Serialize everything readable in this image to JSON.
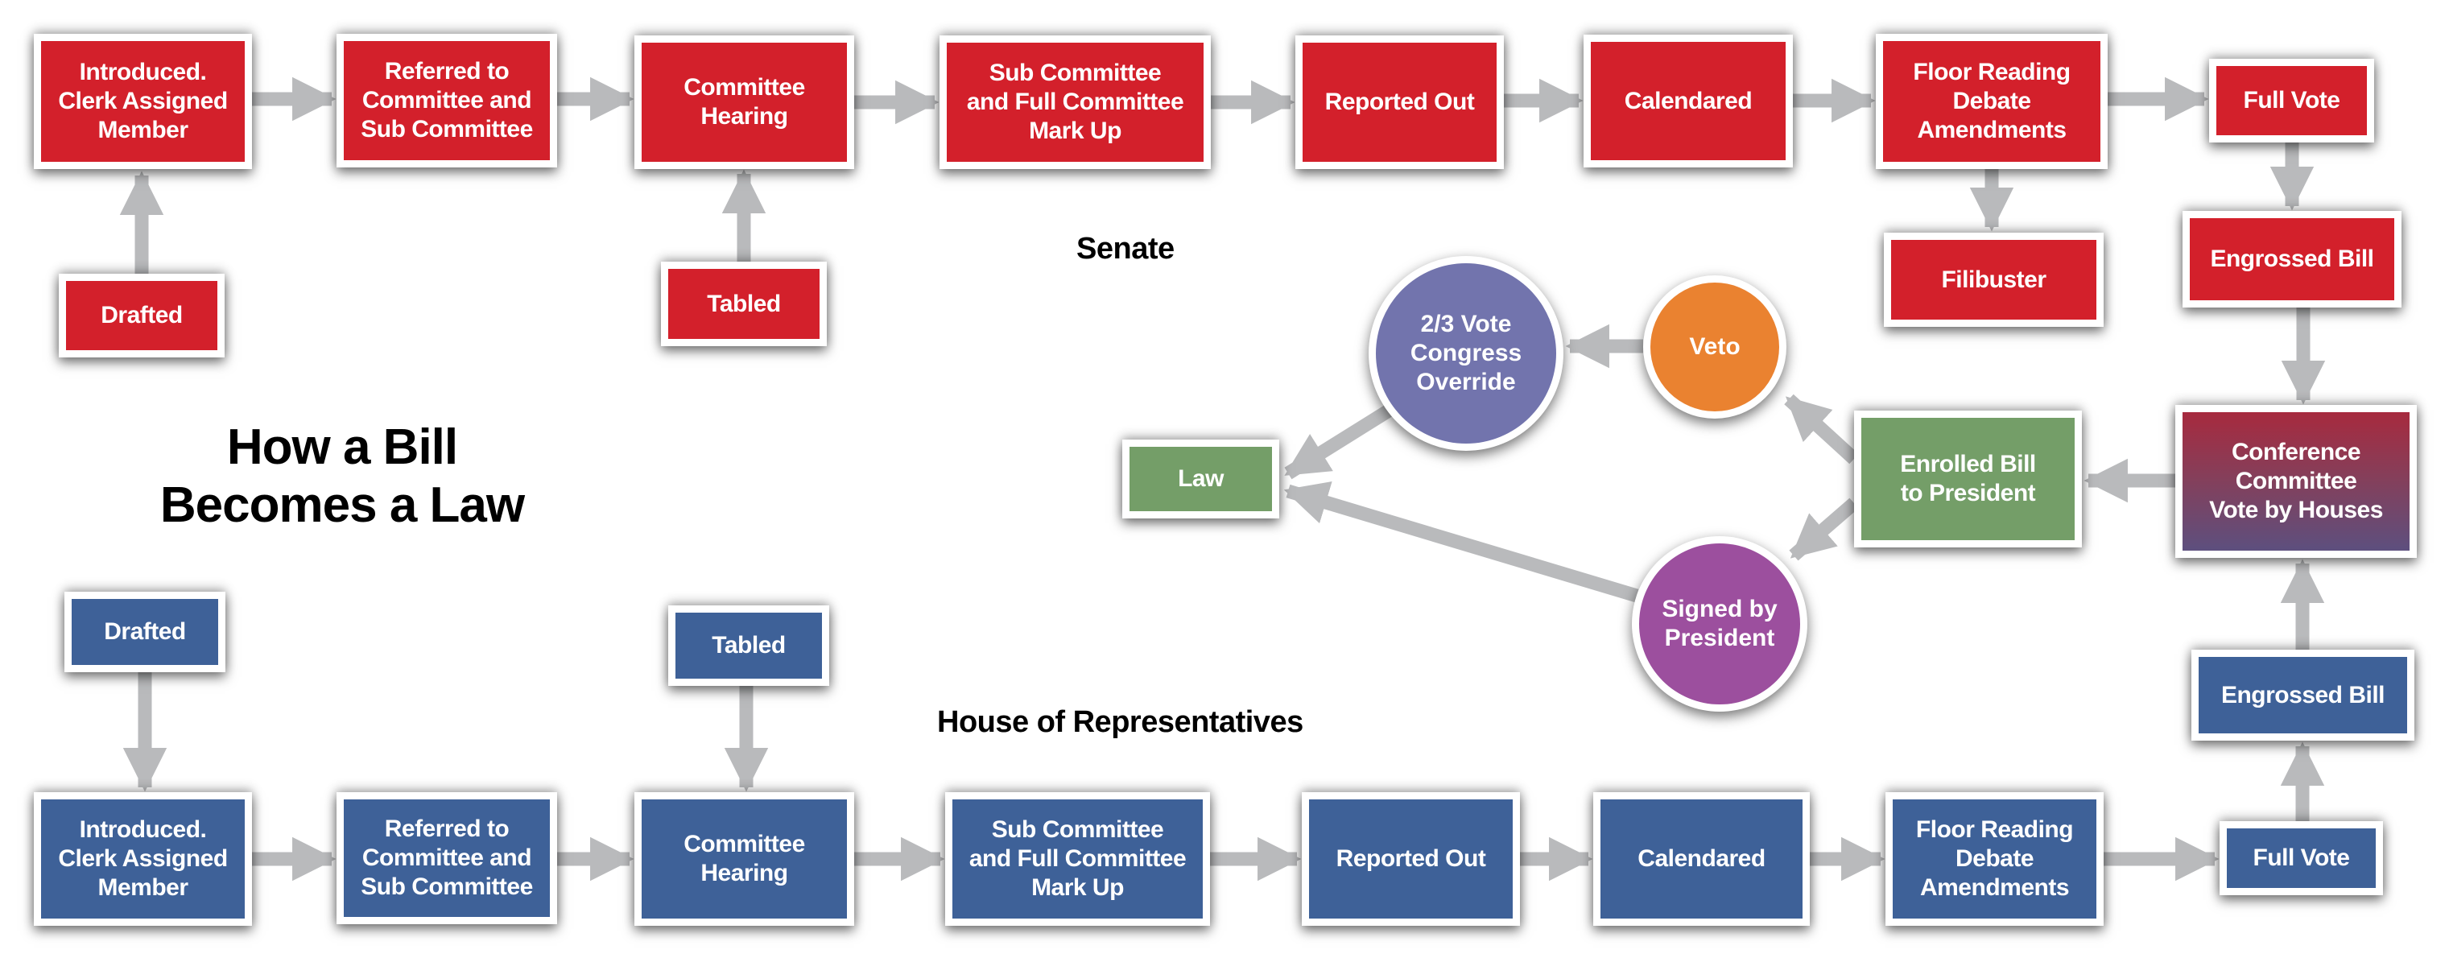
{
  "title": {
    "line1": "How a Bill",
    "line2": "Becomes a Law"
  },
  "labels": {
    "senate": "Senate",
    "house": "House of Representatives"
  },
  "colors": {
    "senate": "#d3202b",
    "house": "#3e6198",
    "law_green": "#749e68",
    "override_purple": "#7274ad",
    "veto_orange": "#ea8230",
    "signed_purple": "#9c4f9e",
    "arrow_gray": "#b9babc"
  },
  "senate": {
    "drafted": "Drafted",
    "introduced": "Introduced.\nClerk Assigned\nMember",
    "referred": "Referred to\nCommittee and\nSub Committee",
    "hearing": "Committee\nHearing",
    "tabled": "Tabled",
    "markup": "Sub Committee\nand Full Committee\nMark Up",
    "reported": "Reported Out",
    "calendared": "Calendared",
    "floor": "Floor Reading\nDebate\nAmendments",
    "filibuster": "Filibuster",
    "full_vote": "Full Vote",
    "engrossed": "Engrossed Bill"
  },
  "house": {
    "drafted": "Drafted",
    "introduced": "Introduced.\nClerk Assigned\nMember",
    "referred": "Referred to\nCommittee and\nSub Committee",
    "hearing": "Committee\nHearing",
    "tabled": "Tabled",
    "markup": "Sub Committee\nand Full Committee\nMark Up",
    "reported": "Reported Out",
    "calendared": "Calendared",
    "floor": "Floor Reading\nDebate\nAmendments",
    "full_vote": "Full Vote",
    "engrossed": "Engrossed Bill"
  },
  "final": {
    "conference": "Conference\nCommittee\nVote by Houses",
    "enrolled": "Enrolled Bill\nto President",
    "veto": "Veto",
    "override": "2/3 Vote\nCongress\nOverride",
    "signed": "Signed by\nPresident",
    "law": "Law"
  },
  "edges": [
    [
      "senate-drafted",
      "senate-introduced"
    ],
    [
      "senate-introduced",
      "senate-referred"
    ],
    [
      "senate-referred",
      "senate-hearing"
    ],
    [
      "senate-tabled",
      "senate-hearing"
    ],
    [
      "senate-hearing",
      "senate-markup"
    ],
    [
      "senate-markup",
      "senate-reported"
    ],
    [
      "senate-reported",
      "senate-calendared"
    ],
    [
      "senate-calendared",
      "senate-floor"
    ],
    [
      "senate-floor",
      "senate-filibuster"
    ],
    [
      "senate-floor",
      "senate-full-vote"
    ],
    [
      "senate-full-vote",
      "senate-engrossed"
    ],
    [
      "senate-engrossed",
      "conference"
    ],
    [
      "house-drafted",
      "house-introduced"
    ],
    [
      "house-introduced",
      "house-referred"
    ],
    [
      "house-referred",
      "house-hearing"
    ],
    [
      "house-tabled",
      "house-hearing"
    ],
    [
      "house-hearing",
      "house-markup"
    ],
    [
      "house-markup",
      "house-reported"
    ],
    [
      "house-reported",
      "house-calendared"
    ],
    [
      "house-calendared",
      "house-floor"
    ],
    [
      "house-floor",
      "house-full-vote"
    ],
    [
      "house-full-vote",
      "house-engrossed"
    ],
    [
      "house-engrossed",
      "conference"
    ],
    [
      "conference",
      "enrolled"
    ],
    [
      "enrolled",
      "veto"
    ],
    [
      "enrolled",
      "signed"
    ],
    [
      "veto",
      "override"
    ],
    [
      "override",
      "law"
    ],
    [
      "signed",
      "law"
    ]
  ]
}
